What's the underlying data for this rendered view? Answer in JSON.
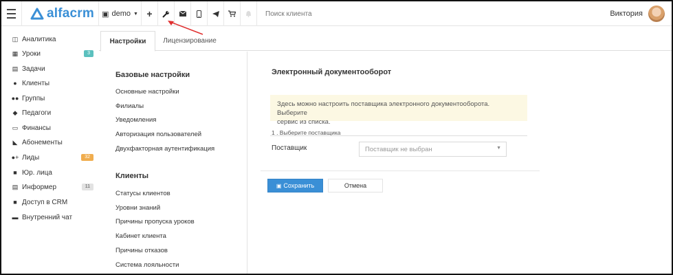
{
  "header": {
    "brand": "alfacrm",
    "demo_label": "demo",
    "search_placeholder": "Поиск клиента",
    "user_name": "Виктория",
    "icons": [
      "plus-icon",
      "wrench-icon",
      "envelope-icon",
      "phone-icon",
      "telegram-icon",
      "cart-icon",
      "bell-icon"
    ]
  },
  "sidebar": {
    "items": [
      {
        "label": "Аналитика",
        "icon": "analytics-icon"
      },
      {
        "label": "Уроки",
        "icon": "calendar-icon",
        "badge": "3"
      },
      {
        "label": "Задачи",
        "icon": "tasks-icon"
      },
      {
        "label": "Клиенты",
        "icon": "user-icon"
      },
      {
        "label": "Группы",
        "icon": "users-icon"
      },
      {
        "label": "Педагоги",
        "icon": "graduation-cap-icon"
      },
      {
        "label": "Финансы",
        "icon": "money-icon"
      },
      {
        "label": "Абонементы",
        "icon": "tag-icon"
      },
      {
        "label": "Лиды",
        "icon": "user-plus-icon",
        "badge": "32"
      },
      {
        "label": "Юр. лица",
        "icon": "briefcase-icon"
      },
      {
        "label": "Информер",
        "icon": "list-icon",
        "badge": "11"
      },
      {
        "label": "Доступ в CRM",
        "icon": "lock-icon"
      },
      {
        "label": "Внутренний чат",
        "icon": "chat-icon"
      }
    ]
  },
  "tabs": [
    {
      "label": "Настройки",
      "active": true
    },
    {
      "label": "Лицензирование",
      "active": false
    }
  ],
  "settings_menu": {
    "sections": [
      {
        "title": "Базовые настройки",
        "items": [
          "Основные настройки",
          "Филиалы",
          "Уведомления",
          "Авторизация пользователей",
          "Двухфакторная аутентификация"
        ]
      },
      {
        "title": "Клиенты",
        "items": [
          "Статусы клиентов",
          "Уровни знаний",
          "Причины пропуска уроков",
          "Кабинет клиента",
          "Причины отказов",
          "Система лояльности"
        ]
      }
    ]
  },
  "content": {
    "title": "Электронный документооборот",
    "alert_line1": "Здесь можно настроить поставщика электронного документооборота. Выберите",
    "alert_line2": "сервис из списка.",
    "step_label": "1 . Выберите поставщика",
    "provider_label": "Поставщик",
    "provider_placeholder": "Поставщик не выбран",
    "save_label": "Сохранить",
    "cancel_label": "Отмена"
  },
  "colors": {
    "accent": "#3a8fd6",
    "alert_bg": "#fcf8e3",
    "annotation_arrow": "#e03030",
    "badge_teal": "#5bc0be",
    "badge_orange": "#f0ad4e"
  }
}
